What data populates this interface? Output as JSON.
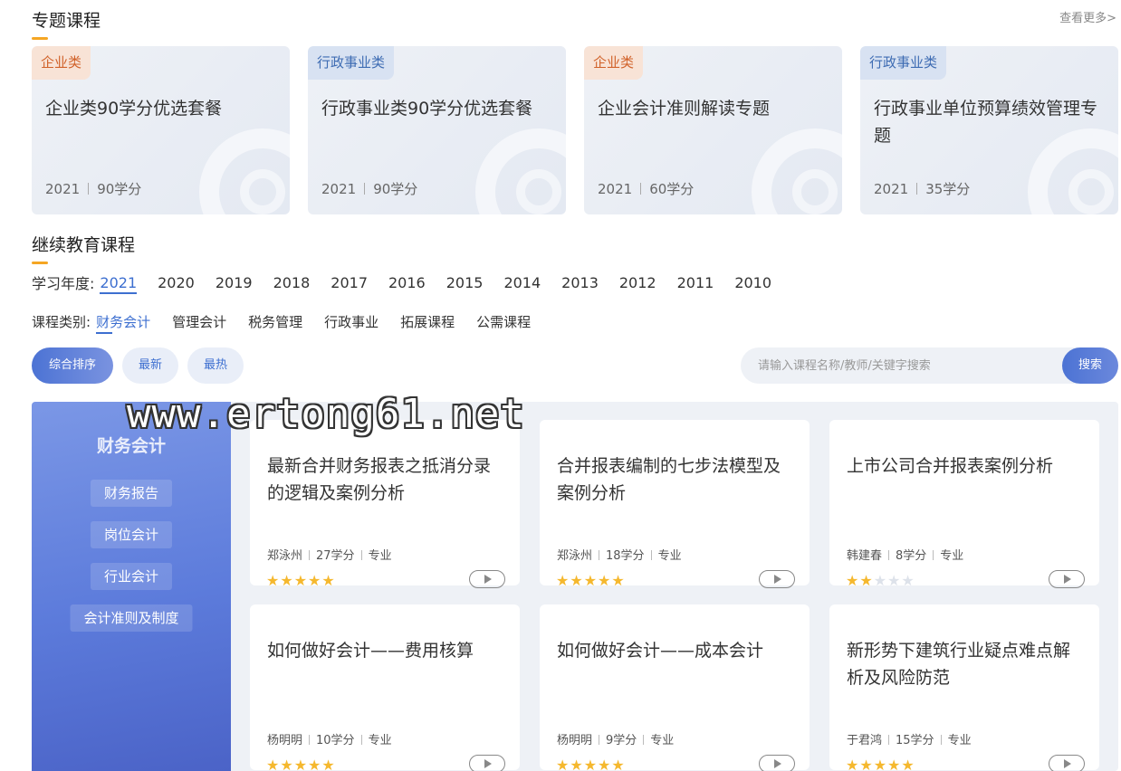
{
  "topic_section": {
    "title": "专题课程",
    "more": "查看更多>",
    "cards": [
      {
        "tag": "企业类",
        "tag_color": "#d1622a",
        "title": "企业类90学分优选套餐",
        "year": "2021",
        "credits": "90学分"
      },
      {
        "tag": "行政事业类",
        "tag_color": "#3e6cb3",
        "title": "行政事业类90学分优选套餐",
        "year": "2021",
        "credits": "90学分"
      },
      {
        "tag": "企业类",
        "tag_color": "#d1622a",
        "title": "企业会计准则解读专题",
        "year": "2021",
        "credits": "60学分"
      },
      {
        "tag": "行政事业类",
        "tag_color": "#3e6cb3",
        "title": "行政事业单位预算绩效管理专题",
        "year": "2021",
        "credits": "35学分"
      }
    ]
  },
  "continuing_section": {
    "title": "继续教育课程",
    "year_label": "学习年度:",
    "years": [
      "2021",
      "2020",
      "2019",
      "2018",
      "2017",
      "2016",
      "2015",
      "2014",
      "2013",
      "2012",
      "2011",
      "2010"
    ],
    "active_year": "2021",
    "category_label": "课程类别:",
    "categories": [
      "财务会计",
      "管理会计",
      "税务管理",
      "行政事业",
      "拓展课程",
      "公需课程"
    ],
    "active_category": "财务会计"
  },
  "sort": {
    "all": "综合排序",
    "newest": "最新",
    "hottest": "最热"
  },
  "search": {
    "placeholder": "请输入课程名称/教师/关键字搜索",
    "button": "搜索"
  },
  "side_panel": {
    "title": "财务会计",
    "items": [
      "财务报告",
      "岗位会计",
      "行业会计",
      "会计准则及制度"
    ]
  },
  "courses": [
    {
      "title": "最新合并财务报表之抵消分录的逻辑及案例分析",
      "teacher": "郑泳州",
      "credits": "27学分",
      "type": "专业",
      "rating": 5
    },
    {
      "title": "合并报表编制的七步法模型及案例分析",
      "teacher": "郑泳州",
      "credits": "18学分",
      "type": "专业",
      "rating": 5
    },
    {
      "title": "上市公司合并报表案例分析",
      "teacher": "韩建春",
      "credits": "8学分",
      "type": "专业",
      "rating": 2
    },
    {
      "title": "如何做好会计——费用核算",
      "teacher": "杨明明",
      "credits": "10学分",
      "type": "专业",
      "rating": 5
    },
    {
      "title": "如何做好会计——成本会计",
      "teacher": "杨明明",
      "credits": "9学分",
      "type": "专业",
      "rating": 5
    },
    {
      "title": "新形势下建筑行业疑点难点解析及风险防范",
      "teacher": "于君鸿",
      "credits": "15学分",
      "type": "专业",
      "rating": 5
    }
  ],
  "watermark": "www.ertong61.net",
  "colors": {
    "accent": "#3d6fd0",
    "underline": "#f5a623",
    "star": "#f5b82e"
  }
}
